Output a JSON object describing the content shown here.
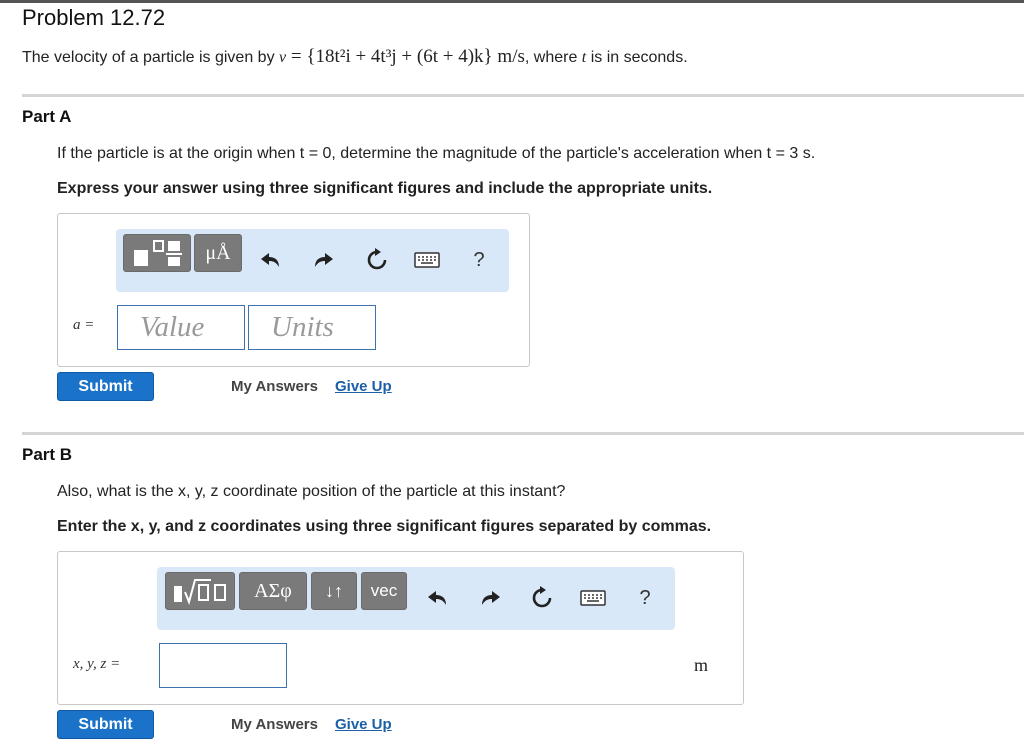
{
  "problem": {
    "title": "Problem 12.72",
    "statement": {
      "prefix": "The velocity of a particle is given by ",
      "var": "v",
      "eq": " = ",
      "expr": "{18t²i + 4t³j + (6t + 4)k} m/s",
      "mid": ", where ",
      "t": "t",
      "suffix": " is in seconds."
    }
  },
  "partA": {
    "title": "Part A",
    "question": "If the particle is at the origin when t = 0, determine the magnitude of the particle's acceleration when t = 3 s.",
    "instruction": "Express your answer using three significant figures and include the appropriate units.",
    "toolbar": {
      "units_button": "μÅ",
      "help": "?",
      "icons": [
        "fraction-template-icon",
        "undo-icon",
        "redo-icon",
        "reset-icon",
        "keyboard-icon"
      ]
    },
    "answer_label": "a =",
    "value_placeholder": "Value",
    "units_placeholder": "Units",
    "submit_label": "Submit",
    "my_answers_label": "My Answers",
    "give_up_label": "Give Up"
  },
  "partB": {
    "title": "Part B",
    "question": "Also, what is the x, y, z coordinate position of the particle at this instant?",
    "instruction": "Enter the x, y, and z coordinates using three significant figures separated by commas.",
    "toolbar": {
      "symbols_button": "ΑΣφ",
      "arrows_button": "↓↑",
      "vec_button": "vec",
      "help": "?",
      "icons": [
        "fraction-sqrt-template-icon",
        "undo-icon",
        "redo-icon",
        "reset-icon",
        "keyboard-icon"
      ]
    },
    "answer_label": "x, y, z =",
    "answer_value": "",
    "unit": "m",
    "submit_label": "Submit",
    "my_answers_label": "My Answers",
    "give_up_label": "Give Up"
  },
  "colors": {
    "submit": "#1a73c8",
    "toolbar_bg": "#d9e8f8",
    "input_border": "#3d71b0",
    "link": "#1a5fa8"
  }
}
